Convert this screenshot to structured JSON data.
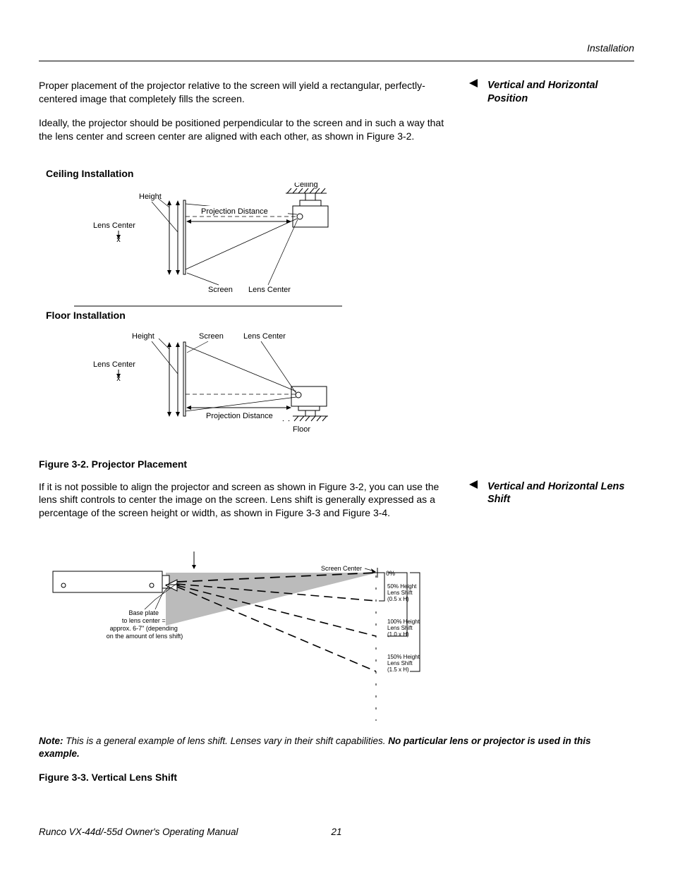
{
  "header": {
    "section": "Installation"
  },
  "sidebar": {
    "position_heading": "Vertical and Horizontal Position",
    "lens_shift_heading": "Vertical and Horizontal Lens Shift"
  },
  "body": {
    "para1": "Proper placement of the projector relative to the screen will yield a rectangular, perfectly-centered image that completely fills the screen.",
    "para2": "Ideally, the projector should be positioned perpendicular to the screen and in such a way that the lens center and screen center are aligned with each other, as shown in Figure 3-2.",
    "para3": "If it is not possible to align the projector and screen as shown in Figure 3-2, you can use the lens shift controls to center the image on the screen. Lens shift is generally expressed as a percentage of the screen height or width, as shown in Figure 3-3 and Figure 3-4."
  },
  "diagram1": {
    "title": "Ceiling Installation",
    "labels": {
      "ceiling": "Ceiling",
      "height": "Height",
      "projection_distance": "Projection Distance",
      "lens_center": "Lens Center",
      "screen": "Screen"
    }
  },
  "diagram2": {
    "title": "Floor Installation",
    "labels": {
      "height": "Height",
      "screen": "Screen",
      "lens_center": "Lens Center",
      "projection_distance": "Projection Distance",
      "floor": "Floor"
    }
  },
  "diagram3": {
    "labels": {
      "screen_center": "Screen Center",
      "zero_pct": "0%",
      "base_plate": "Base plate\nto lens center =\napprox. 6-7\" (depending\non the amount of lens shift)",
      "shift_50": "50% Height\nLens Shift\n(0.5 x H)",
      "shift_100": "100% Height\nLens Shift\n(1.0 x H)",
      "shift_150": "150% Height\nLens Shift\n(1.5 x H)"
    }
  },
  "figures": {
    "fig32": "Figure 3-2. Projector Placement",
    "fig33": "Figure 3-3. Vertical Lens Shift"
  },
  "note": {
    "prefix": "Note:",
    "text": " This is a general example of lens shift. Lenses vary in their shift capabilities. ",
    "bold_end": "No particular lens or projector is used in this example."
  },
  "footer": {
    "manual": "Runco VX-44d/-55d Owner's Operating Manual",
    "page": "21"
  }
}
